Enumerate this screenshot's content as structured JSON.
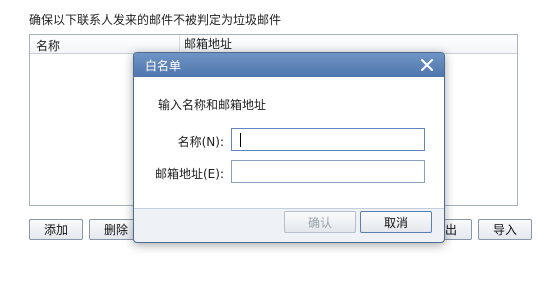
{
  "background": {
    "instruction": "确保以下联系人发来的邮件不被判定为垃圾邮件",
    "columns": {
      "name": "名称",
      "address": "邮箱地址"
    },
    "buttons": {
      "add": "添加",
      "delete": "删除",
      "export": "出",
      "import": "导入"
    }
  },
  "dialog": {
    "title": "白名单",
    "prompt": "输入名称和邮箱地址",
    "name_label": "名称(N):",
    "email_label": "邮箱地址(E):",
    "name_value": "",
    "email_value": "",
    "ok_label": "确认",
    "cancel_label": "取消"
  },
  "colors": {
    "titlebar": "#5a80b6",
    "accent_border": "#4d6b95",
    "disabled_text": "#9aa3ad"
  },
  "icons": {
    "close": "close-icon"
  }
}
